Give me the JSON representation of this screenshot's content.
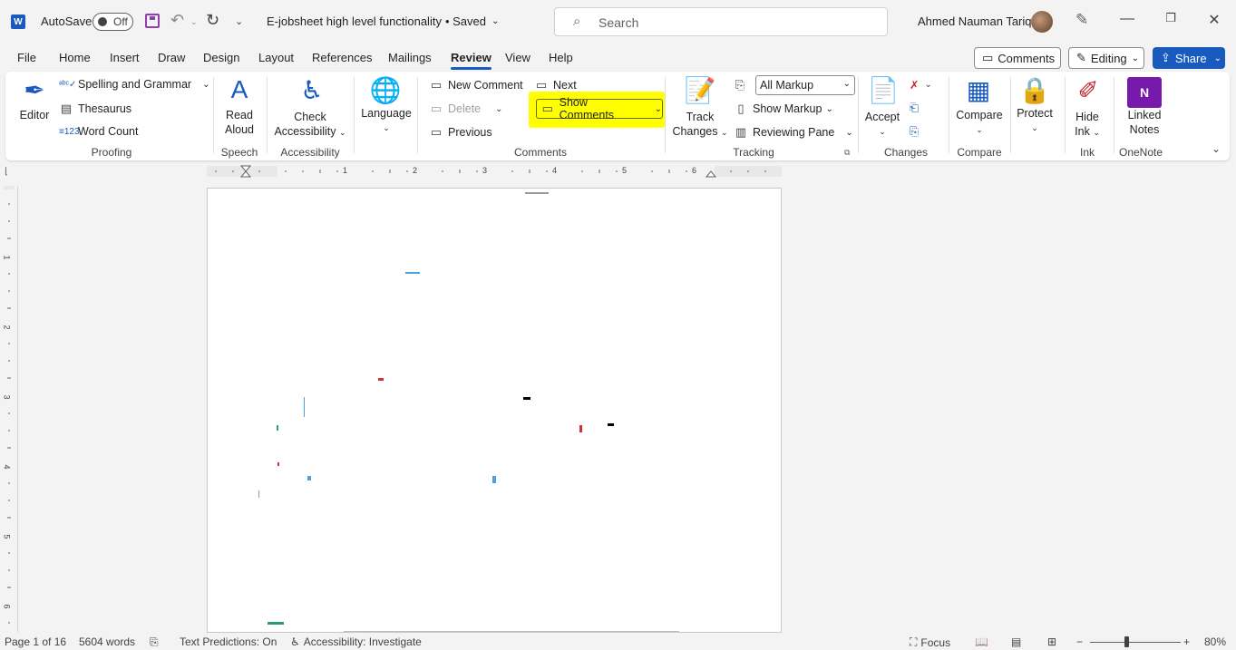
{
  "titlebar": {
    "app_logo": "W",
    "autosave_label": "AutoSave",
    "autosave_state": "Off",
    "doc_title": "E-jobsheet high level functionality",
    "save_status": "• Saved",
    "search_placeholder": "Search",
    "user_name": "Ahmed Nauman Tariq"
  },
  "tabs": [
    "File",
    "Home",
    "Insert",
    "Draw",
    "Design",
    "Layout",
    "References",
    "Mailings",
    "Review",
    "View",
    "Help"
  ],
  "active_tab": "Review",
  "top_right": {
    "comments_label": "Comments",
    "editing_label": "Editing",
    "share_label": "Share"
  },
  "ribbon": {
    "editor": "Editor",
    "spelling": "Spelling and Grammar",
    "thesaurus": "Thesaurus",
    "word_count": "Word Count",
    "proofing": "Proofing",
    "read": "Read",
    "aloud": "Aloud",
    "speech": "Speech",
    "check": "Check",
    "accessibility_btn": "Accessibility",
    "accessibility_group": "Accessibility",
    "language": "Language",
    "new_comment": "New Comment",
    "delete": "Delete",
    "previous": "Previous",
    "next": "Next",
    "show_comments": "Show Comments",
    "comments_group": "Comments",
    "track": "Track",
    "changes_btn": "Changes",
    "markup_value": "All Markup",
    "show_markup": "Show Markup",
    "reviewing_pane": "Reviewing Pane",
    "tracking": "Tracking",
    "accept": "Accept",
    "changes_group": "Changes",
    "compare_btn": "Compare",
    "compare_group": "Compare",
    "protect": "Protect",
    "hide": "Hide",
    "ink_btn": "Ink",
    "ink_group": "Ink",
    "linked": "Linked",
    "notes": "Notes",
    "onenote_group": "OneNote",
    "onenote_logo": "N"
  },
  "ruler": {
    "h_numbers": [
      "1",
      "2",
      "3",
      "4",
      "5",
      "6"
    ],
    "v_numbers": [
      "1",
      "2",
      "3",
      "4",
      "5",
      "6"
    ]
  },
  "status": {
    "page": "Page 1 of 16",
    "words": "5604 words",
    "text_predictions": "Text Predictions: On",
    "accessibility": "Accessibility: Investigate",
    "focus": "Focus",
    "zoom": "80%",
    "zoom_level": 0.5
  },
  "colors": {
    "accent": "#185abd",
    "highlight": "#ffff00",
    "onenote": "#7719aa"
  }
}
